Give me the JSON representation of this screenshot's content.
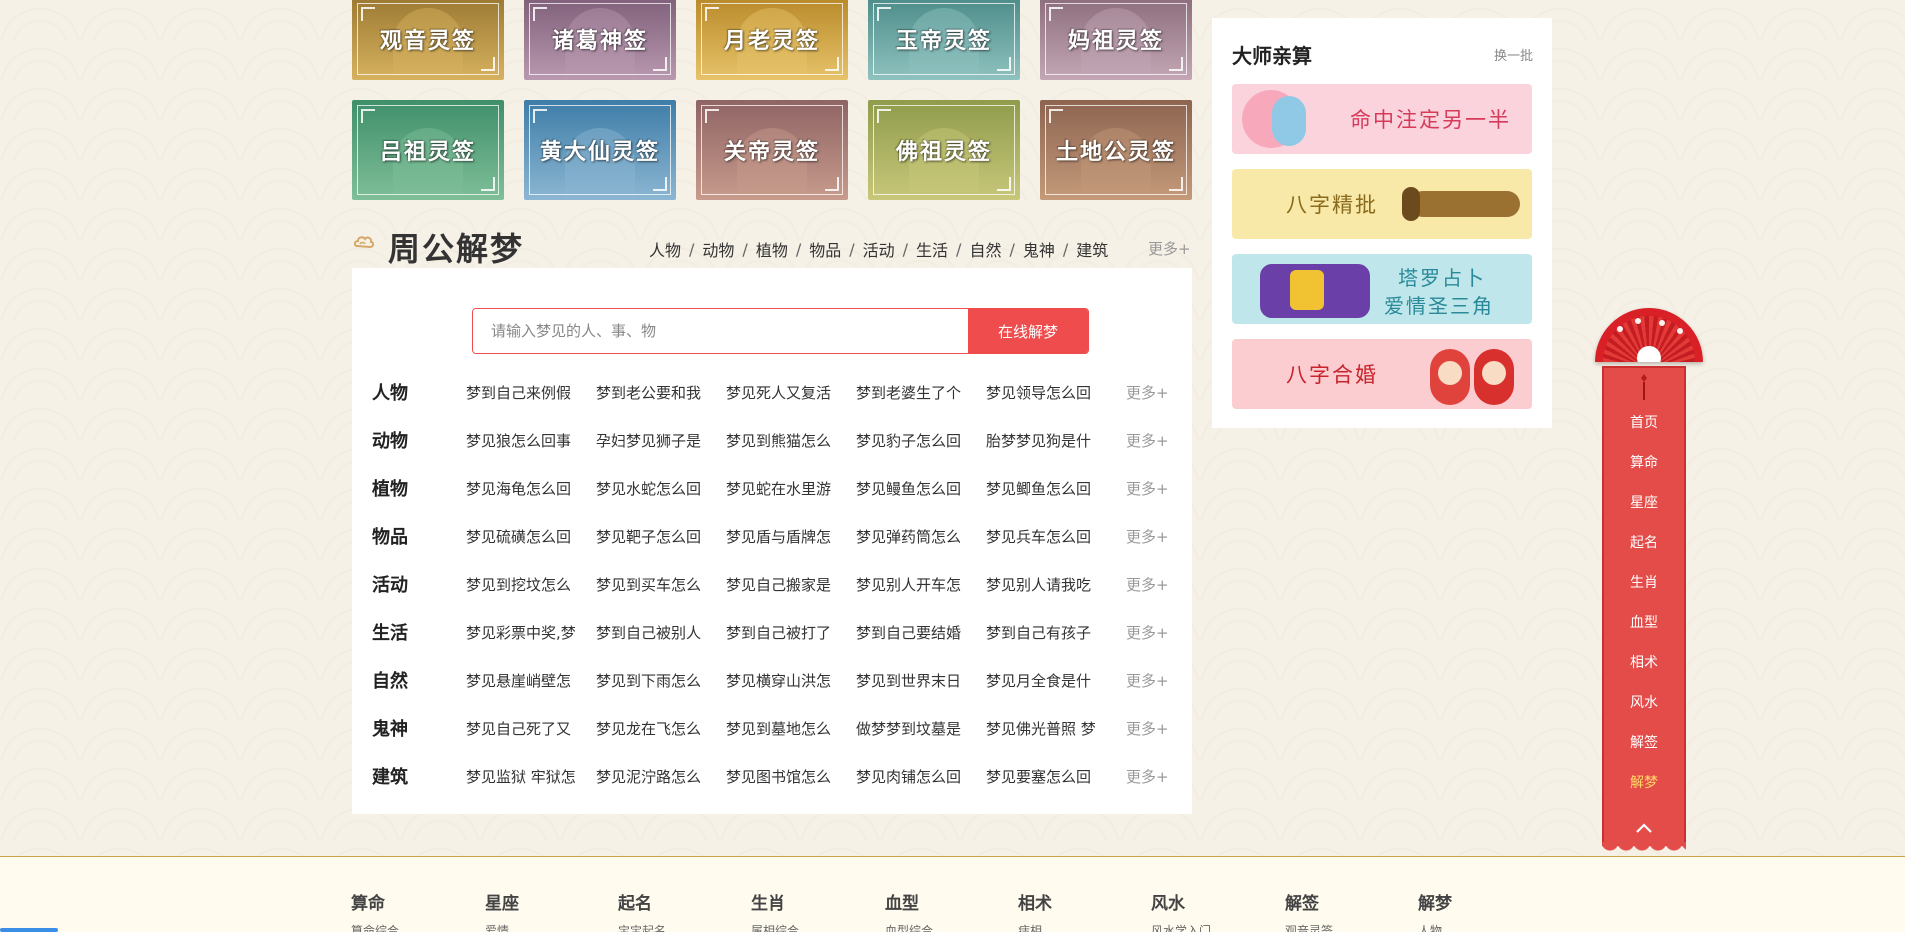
{
  "lottery_cards": [
    {
      "label": "观音灵签",
      "bg": "#9c7a33",
      "accent": "#d6b25f"
    },
    {
      "label": "诸葛神签",
      "bg": "#80607a",
      "accent": "#b899b0"
    },
    {
      "label": "月老灵签",
      "bg": "#b98a2a",
      "accent": "#e7c36a"
    },
    {
      "label": "玉帝灵签",
      "bg": "#4d8d8a",
      "accent": "#8fc2bf"
    },
    {
      "label": "妈祖灵签",
      "bg": "#8c6e7d",
      "accent": "#c4a7b5"
    },
    {
      "label": "吕祖灵签",
      "bg": "#3f8f6b",
      "accent": "#7fbf98"
    },
    {
      "label": "黄大仙灵签",
      "bg": "#3e7da8",
      "accent": "#8cb6d2"
    },
    {
      "label": "关帝灵签",
      "bg": "#8f6464",
      "accent": "#c79b8c"
    },
    {
      "label": "佛祖灵签",
      "bg": "#8f9c4b",
      "accent": "#c8c77a"
    },
    {
      "label": "土地公灵签",
      "bg": "#8d6450",
      "accent": "#c49a7a"
    }
  ],
  "dream": {
    "title": "周公解梦",
    "nav": [
      "人物",
      "动物",
      "植物",
      "物品",
      "活动",
      "生活",
      "自然",
      "鬼神",
      "建筑"
    ],
    "nav_more": "更多+",
    "search_placeholder": "请输入梦见的人、事、物",
    "search_button": "在线解梦",
    "rows": [
      {
        "label": "人物",
        "items": [
          "梦到自己来例假",
          "梦到老公要和我",
          "梦见死人又复活",
          "梦到老婆生了个",
          "梦见领导怎么回"
        ],
        "more": "更多+"
      },
      {
        "label": "动物",
        "items": [
          "梦见狼怎么回事",
          "孕妇梦见狮子是",
          "梦见到熊猫怎么",
          "梦见豹子怎么回",
          "胎梦梦见狗是什"
        ],
        "more": "更多+"
      },
      {
        "label": "植物",
        "items": [
          "梦见海龟怎么回",
          "梦见水蛇怎么回",
          "梦见蛇在水里游",
          "梦见鳗鱼怎么回",
          "梦见鲫鱼怎么回"
        ],
        "more": "更多+"
      },
      {
        "label": "物品",
        "items": [
          "梦见硫磺怎么回",
          "梦见靶子怎么回",
          "梦见盾与盾牌怎",
          "梦见弹药筒怎么",
          "梦见兵车怎么回"
        ],
        "more": "更多+"
      },
      {
        "label": "活动",
        "items": [
          "梦见到挖坟怎么",
          "梦见到买车怎么",
          "梦见自己搬家是",
          "梦见别人开车怎",
          "梦见别人请我吃"
        ],
        "more": "更多+"
      },
      {
        "label": "生活",
        "items": [
          "梦见彩票中奖,梦",
          "梦到自己被别人",
          "梦到自己被打了",
          "梦到自己要结婚",
          "梦到自己有孩子"
        ],
        "more": "更多+"
      },
      {
        "label": "自然",
        "items": [
          "梦见悬崖峭壁怎",
          "梦见到下雨怎么",
          "梦见横穿山洪怎",
          "梦见到世界末日",
          "梦见月全食是什"
        ],
        "more": "更多+"
      },
      {
        "label": "鬼神",
        "items": [
          "梦见自己死了又",
          "梦见龙在飞怎么",
          "梦见到墓地怎么",
          "做梦梦到坟墓是",
          "梦见佛光普照 梦"
        ],
        "more": "更多+"
      },
      {
        "label": "建筑",
        "items": [
          "梦见监狱 牢狱怎",
          "梦见泥泞路怎么",
          "梦见图书馆怎么",
          "梦见肉铺怎么回",
          "梦见要塞怎么回"
        ],
        "more": "更多+"
      }
    ]
  },
  "sidebar": {
    "title": "大师亲算",
    "refresh": "换一批",
    "banners": [
      {
        "text": "命中注定另一半",
        "bg": "#fbd3dc",
        "color": "#d63a5a"
      },
      {
        "text": "八字精批",
        "bg": "#f8e9a8",
        "color": "#8a6a1c"
      },
      {
        "text_line1": "塔罗占卜",
        "text_line2": "爱情圣三角",
        "bg": "#bfe6ea",
        "color": "#2a8a9a"
      },
      {
        "text": "八字合婚",
        "bg": "#fbcdd0",
        "color": "#c8242d"
      }
    ]
  },
  "float_nav": {
    "items": [
      "首页",
      "算命",
      "星座",
      "起名",
      "生肖",
      "血型",
      "相术",
      "风水",
      "解签",
      "解梦"
    ],
    "active_index": 9
  },
  "footer": {
    "columns": [
      {
        "title": "算命",
        "sub": "算命综合"
      },
      {
        "title": "星座",
        "sub": "爱情"
      },
      {
        "title": "起名",
        "sub": "宝宝起名"
      },
      {
        "title": "生肖",
        "sub": "属相综合"
      },
      {
        "title": "血型",
        "sub": "血型综合"
      },
      {
        "title": "相术",
        "sub": "痣相"
      },
      {
        "title": "风水",
        "sub": "风水学入门"
      },
      {
        "title": "解签",
        "sub": "观音灵签"
      },
      {
        "title": "解梦",
        "sub": "人物"
      }
    ]
  }
}
